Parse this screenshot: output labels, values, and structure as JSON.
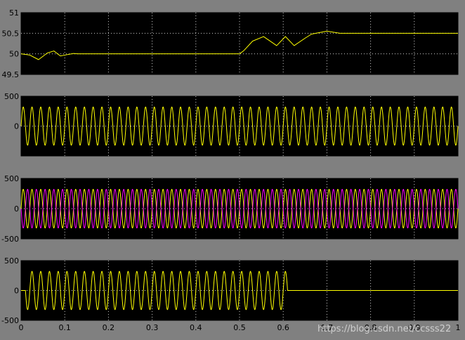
{
  "window": {
    "background": "#808080",
    "axes_background": "#000000",
    "grid_color": "#ffffff"
  },
  "watermark": "https://blog.csdn.net/ccsss22",
  "chart_data": [
    {
      "type": "line",
      "title": "",
      "xlim": [
        0,
        1
      ],
      "ylim": [
        49.5,
        51
      ],
      "y_ticks": [
        "49.5",
        "50",
        "50.5",
        "51"
      ],
      "grid": true,
      "series": [
        {
          "color": "#ffff00",
          "x": [
            0,
            0.02,
            0.04,
            0.06,
            0.075,
            0.09,
            0.1,
            0.12,
            0.13,
            0.2,
            0.3,
            0.4,
            0.5,
            0.51,
            0.53,
            0.555,
            0.585,
            0.605,
            0.625,
            0.65,
            0.665,
            0.7,
            0.73,
            0.75,
            1.0
          ],
          "y": [
            50,
            49.97,
            49.86,
            50.02,
            50.07,
            49.95,
            49.97,
            50.01,
            50.0,
            50.0,
            50.0,
            50.0,
            50.0,
            50.08,
            50.31,
            50.42,
            50.2,
            50.42,
            50.2,
            50.38,
            50.48,
            50.55,
            50.5,
            50.5,
            50.5
          ]
        }
      ]
    },
    {
      "type": "line",
      "title": "",
      "xlim": [
        0,
        1
      ],
      "ylim": [
        -500,
        500
      ],
      "y_ticks": [
        "500",
        "0"
      ],
      "grid": true,
      "series": [
        {
          "color": "#ffff00",
          "waveform": "sine",
          "frequency_hz": 50,
          "amplitude": 320,
          "start": 0,
          "end": 1
        }
      ]
    },
    {
      "type": "line",
      "title": "",
      "xlim": [
        0,
        1
      ],
      "ylim": [
        -500,
        500
      ],
      "y_ticks": [
        "500",
        "0",
        "-500"
      ],
      "grid": true,
      "series": [
        {
          "color": "#ffff00",
          "waveform": "sine",
          "frequency_hz": 50,
          "amplitude": 320,
          "start": 0,
          "end": 1,
          "phase_deg": 0
        },
        {
          "color": "#ff00ff",
          "waveform": "sine",
          "frequency_hz": 50,
          "amplitude": 320,
          "start": 0,
          "end": 1,
          "phase_deg": 180
        }
      ]
    },
    {
      "type": "line",
      "title": "",
      "xlim": [
        0,
        1
      ],
      "ylim": [
        -500,
        500
      ],
      "y_ticks": [
        "500",
        "0",
        "-500"
      ],
      "x_ticks": [
        "0",
        "0.1",
        "0.2",
        "0.3",
        "0.4",
        "0.5",
        "0.6",
        "0.7",
        "0.8",
        "0.9",
        "1"
      ],
      "grid": true,
      "series": [
        {
          "color": "#ffff00",
          "waveform": "sine",
          "frequency_hz": 50,
          "amplitude": 320,
          "start": 0.01,
          "end": 0.61
        }
      ]
    }
  ]
}
